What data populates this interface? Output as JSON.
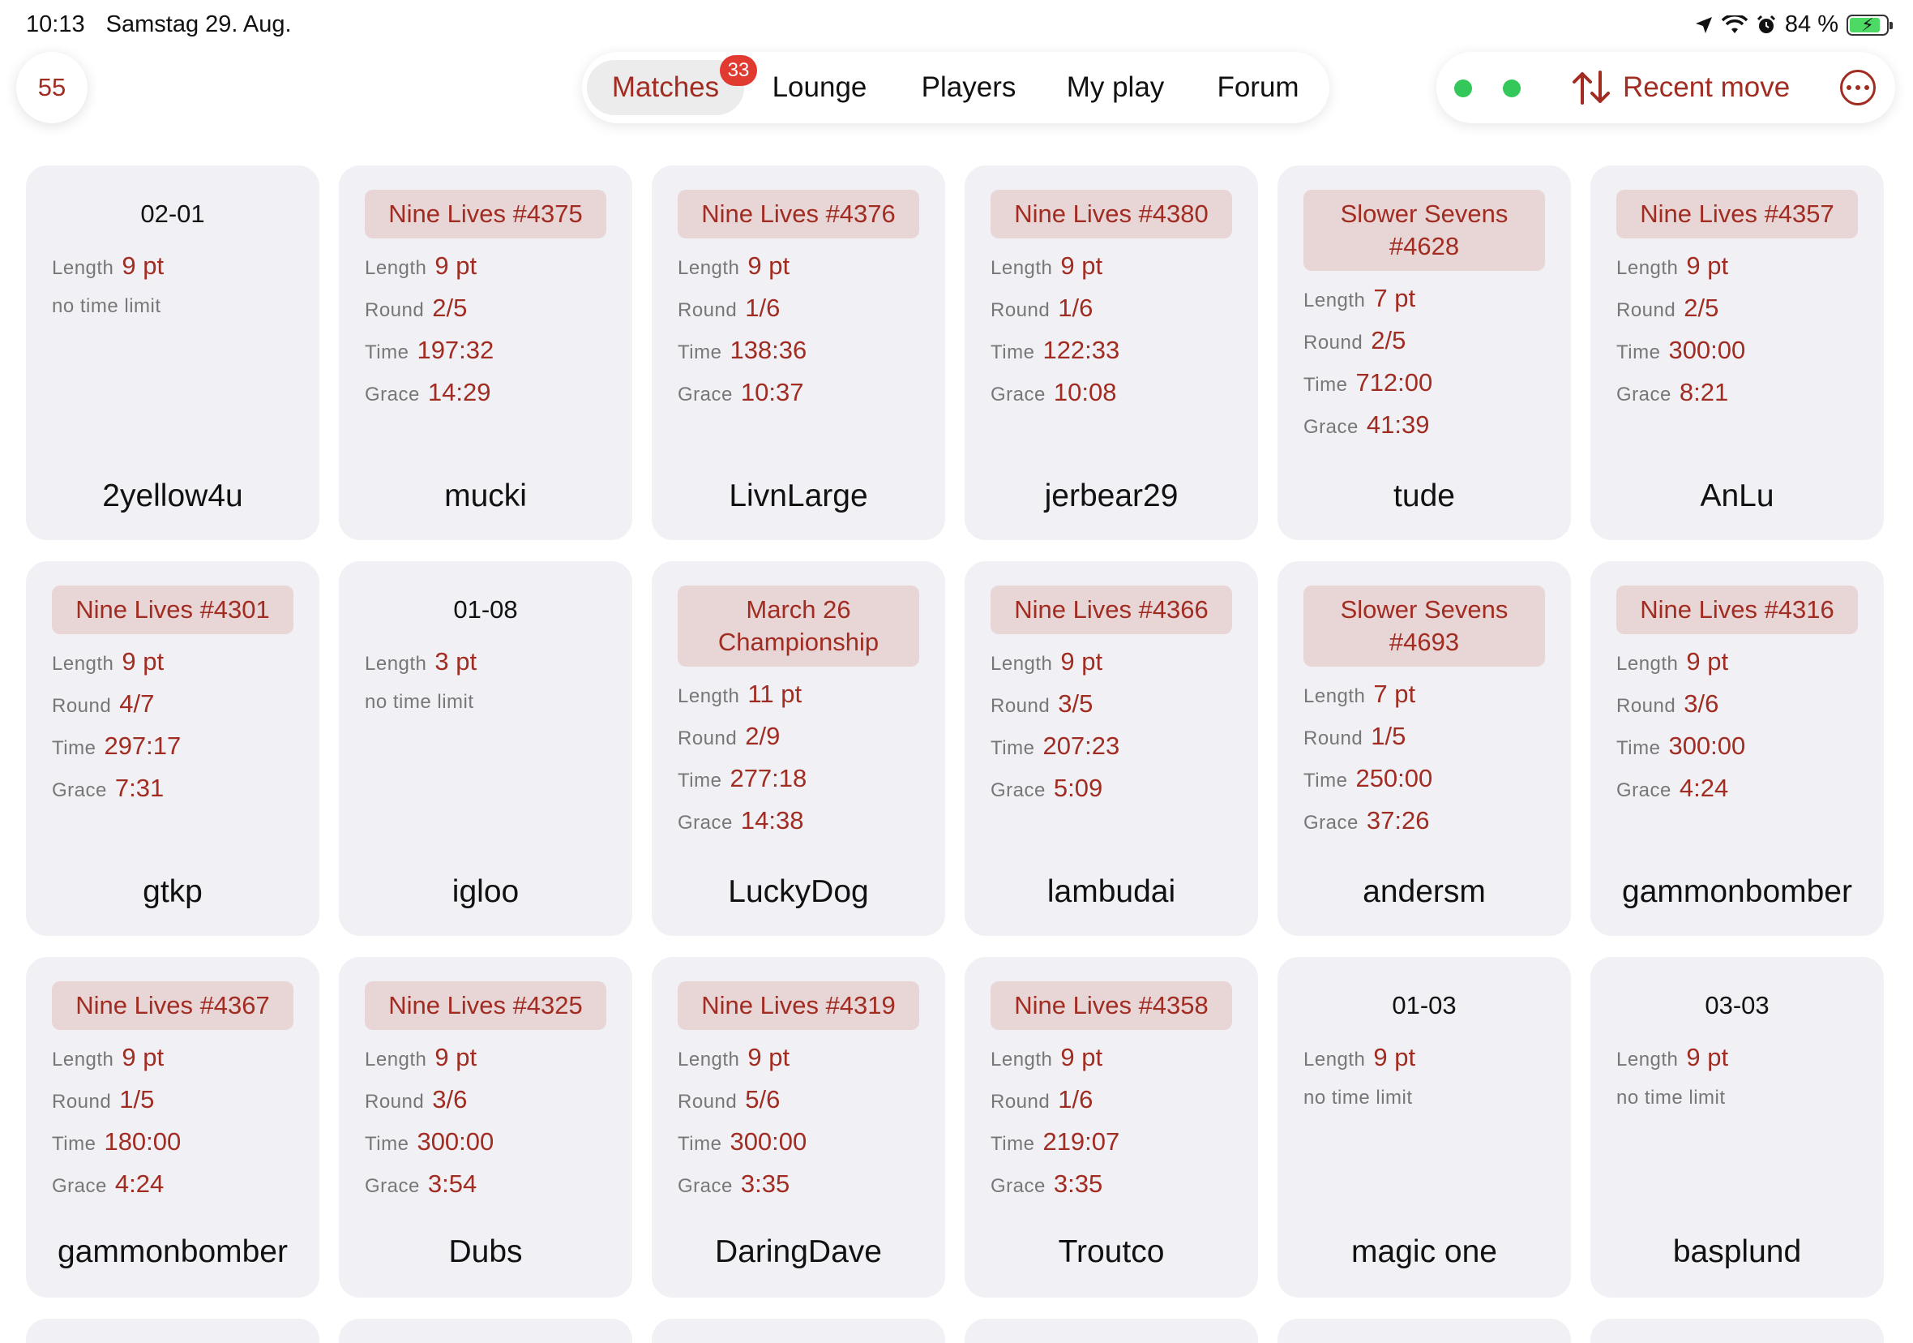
{
  "status": {
    "time": "10:13",
    "date": "Samstag 29. Aug.",
    "battery": "84 %",
    "battery_level": 0.84
  },
  "score": "55",
  "tabs": [
    {
      "label": "Matches",
      "active": true,
      "badge": "33"
    },
    {
      "label": "Lounge"
    },
    {
      "label": "Players"
    },
    {
      "label": "My play"
    },
    {
      "label": "Forum"
    }
  ],
  "right_bar": {
    "recent_label": "Recent move"
  },
  "colors": {
    "accent": "#a02c22",
    "status_dot": "#34c759",
    "badge": "#e03a31",
    "title_bg": "#e8d5d5",
    "card_bg": "#f1f1f5"
  },
  "labels": {
    "length": "Length",
    "round": "Round",
    "time": "Time",
    "grace": "Grace"
  },
  "matches": [
    {
      "title": "02-01",
      "styled": false,
      "length": "9 pt",
      "note": "no time limit",
      "player": "2yellow4u"
    },
    {
      "title": "Nine Lives #4375",
      "styled": true,
      "length": "9 pt",
      "round": "2/5",
      "time": "197:32",
      "grace": "14:29",
      "player": "mucki"
    },
    {
      "title": "Nine Lives #4376",
      "styled": true,
      "length": "9 pt",
      "round": "1/6",
      "time": "138:36",
      "grace": "10:37",
      "player": "LivnLarge"
    },
    {
      "title": "Nine Lives #4380",
      "styled": true,
      "length": "9 pt",
      "round": "1/6",
      "time": "122:33",
      "grace": "10:08",
      "player": "jerbear29"
    },
    {
      "title": "Slower Sevens #4628",
      "styled": true,
      "length": "7 pt",
      "round": "2/5",
      "time": "712:00",
      "grace": "41:39",
      "player": "tude"
    },
    {
      "title": "Nine Lives #4357",
      "styled": true,
      "length": "9 pt",
      "round": "2/5",
      "time": "300:00",
      "grace": "8:21",
      "player": "AnLu"
    },
    {
      "title": "Nine Lives #4301",
      "styled": true,
      "length": "9 pt",
      "round": "4/7",
      "time": "297:17",
      "grace": "7:31",
      "player": "gtkp"
    },
    {
      "title": "01-08",
      "styled": false,
      "length": "3 pt",
      "note": "no time limit",
      "player": "igloo"
    },
    {
      "title": "March 26 Championship",
      "styled": true,
      "length": "11 pt",
      "round": "2/9",
      "time": "277:18",
      "grace": "14:38",
      "player": "LuckyDog"
    },
    {
      "title": "Nine Lives #4366",
      "styled": true,
      "length": "9 pt",
      "round": "3/5",
      "time": "207:23",
      "grace": "5:09",
      "player": "lambudai"
    },
    {
      "title": "Slower Sevens #4693",
      "styled": true,
      "length": "7 pt",
      "round": "1/5",
      "time": "250:00",
      "grace": "37:26",
      "player": "andersm"
    },
    {
      "title": "Nine Lives #4316",
      "styled": true,
      "length": "9 pt",
      "round": "3/6",
      "time": "300:00",
      "grace": "4:24",
      "player": "gammonbomber"
    },
    {
      "title": "Nine Lives #4367",
      "styled": true,
      "length": "9 pt",
      "round": "1/5",
      "time": "180:00",
      "grace": "4:24",
      "player": "gammonbomber"
    },
    {
      "title": "Nine Lives #4325",
      "styled": true,
      "length": "9 pt",
      "round": "3/6",
      "time": "300:00",
      "grace": "3:54",
      "player": "Dubs"
    },
    {
      "title": "Nine Lives #4319",
      "styled": true,
      "length": "9 pt",
      "round": "5/6",
      "time": "300:00",
      "grace": "3:35",
      "player": "DaringDave"
    },
    {
      "title": "Nine Lives #4358",
      "styled": true,
      "length": "9 pt",
      "round": "1/6",
      "time": "219:07",
      "grace": "3:35",
      "player": "Troutco"
    },
    {
      "title": "01-03",
      "styled": false,
      "length": "9 pt",
      "note": "no time limit",
      "player": "magic one"
    },
    {
      "title": "03-03",
      "styled": false,
      "length": "9 pt",
      "note": "no time limit",
      "player": "basplund"
    }
  ]
}
